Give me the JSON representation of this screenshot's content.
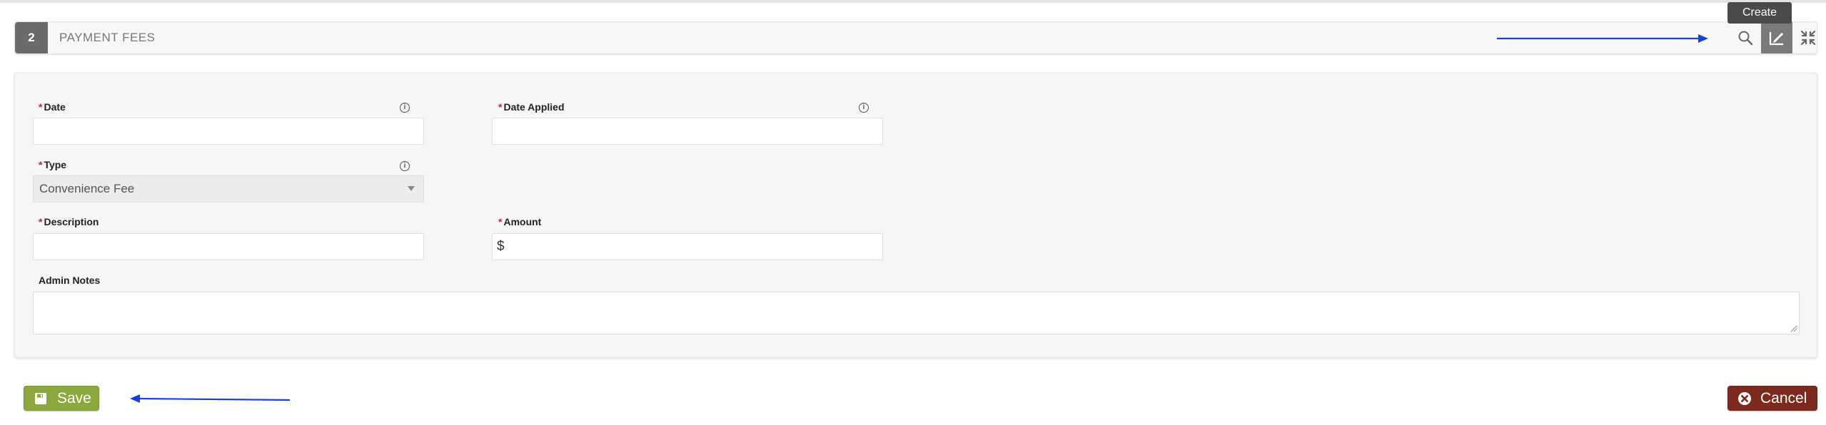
{
  "section": {
    "step_number": "2",
    "title": "PAYMENT FEES",
    "tooltip": "Create"
  },
  "form": {
    "date": {
      "label": "Date",
      "value": "",
      "required": "*"
    },
    "date_applied": {
      "label": "Date Applied",
      "value": "",
      "required": "*"
    },
    "type": {
      "label": "Type",
      "selected": "Convenience Fee",
      "required": "*"
    },
    "description": {
      "label": "Description",
      "value": "",
      "required": "*"
    },
    "amount": {
      "label": "Amount",
      "prefix": "$",
      "value": "",
      "required": "*"
    },
    "admin_notes": {
      "label": "Admin Notes",
      "value": ""
    }
  },
  "actions": {
    "save_label": "Save",
    "cancel_label": "Cancel"
  },
  "colors": {
    "save": "#8aa83b",
    "cancel": "#7d2a1e",
    "annotation_arrow": "#1a3fd6",
    "required_marker": "#c62828"
  },
  "icons": [
    "search-icon",
    "create-icon",
    "collapse-icon",
    "info-icon",
    "save-icon",
    "cancel-icon"
  ]
}
